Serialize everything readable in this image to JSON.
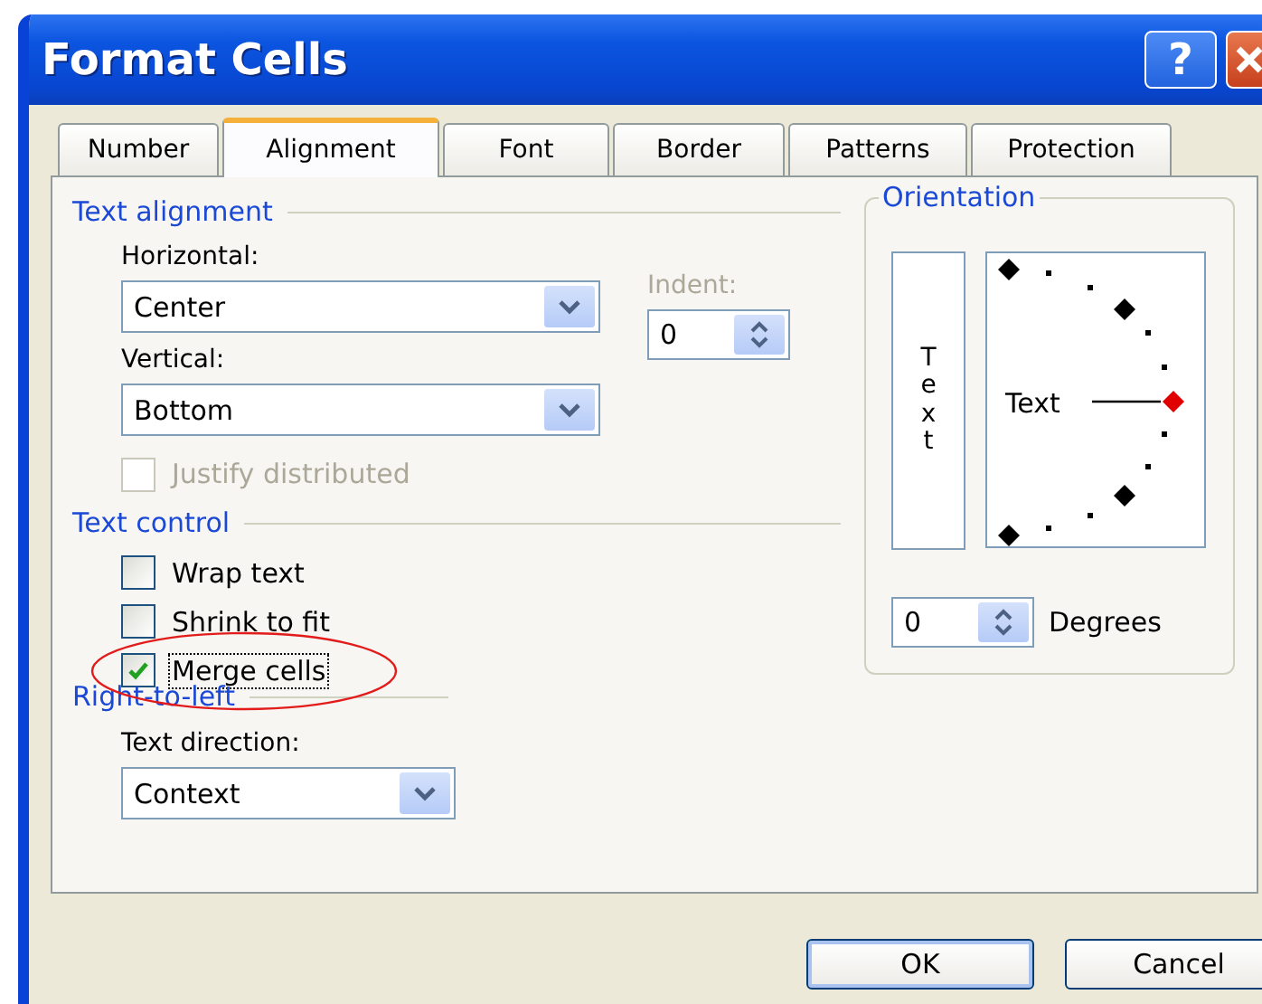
{
  "window": {
    "title": "Format Cells",
    "buttons": [
      {
        "kind": "help",
        "label": "?"
      },
      {
        "kind": "close"
      }
    ]
  },
  "tabs": [
    {
      "label": "Number",
      "selected": false
    },
    {
      "label": "Alignment",
      "selected": true
    },
    {
      "label": "Font",
      "selected": false
    },
    {
      "label": "Border",
      "selected": false
    },
    {
      "label": "Patterns",
      "selected": false
    },
    {
      "label": "Protection",
      "selected": false
    }
  ],
  "text_alignment": {
    "heading": "Text alignment",
    "horizontal": {
      "label": "Horizontal:",
      "value": "Center"
    },
    "vertical": {
      "label": "Vertical:",
      "value": "Bottom"
    },
    "indent": {
      "label": "Indent:",
      "value": "0",
      "disabled": true
    },
    "justify": {
      "label": "Justify distributed",
      "checked": false,
      "disabled": true
    }
  },
  "text_control": {
    "heading": "Text control",
    "options": [
      {
        "label": "Wrap text",
        "checked": false,
        "highlighted": false
      },
      {
        "label": "Shrink to fit",
        "checked": false,
        "highlighted": false
      },
      {
        "label": "Merge cells",
        "checked": true,
        "highlighted": true
      }
    ]
  },
  "right_to_left": {
    "heading": "Right-to-left",
    "direction": {
      "label": "Text direction:",
      "value": "Context"
    }
  },
  "orientation": {
    "heading": "Orientation",
    "vertical_text": "Text",
    "dial_text": "Text",
    "degrees": {
      "value": "0",
      "label": "Degrees"
    }
  },
  "buttons": [
    "OK",
    "Cancel"
  ]
}
